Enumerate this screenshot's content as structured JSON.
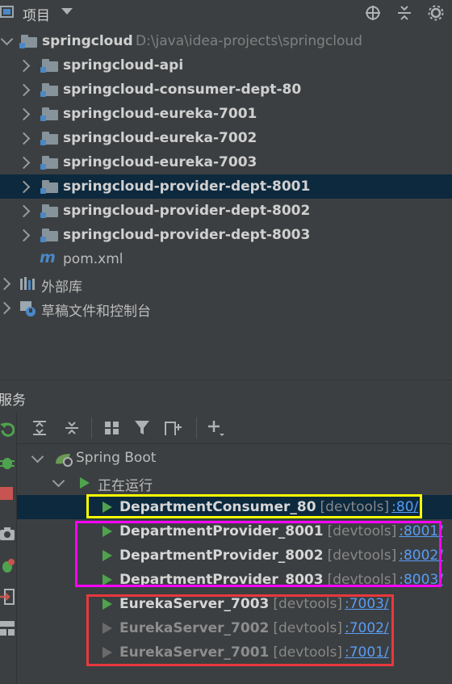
{
  "project_panel": {
    "title": "项目",
    "root": {
      "name": "springcloud",
      "path": "D:\\java\\idea-projects\\springcloud"
    },
    "modules": [
      "springcloud-api",
      "springcloud-consumer-dept-80",
      "springcloud-eureka-7001",
      "springcloud-eureka-7002",
      "springcloud-eureka-7003",
      "springcloud-provider-dept-8001",
      "springcloud-provider-dept-8002",
      "springcloud-provider-dept-8003"
    ],
    "pom_file": "pom.xml",
    "external_libraries": "外部库",
    "scratches": "草稿文件和控制台"
  },
  "services_panel": {
    "title": "服务",
    "spring_boot_label": "Spring Boot",
    "running_label": "正在运行",
    "services": [
      {
        "name": "DepartmentConsumer_80",
        "tag": "[devtools]",
        "port": ":80/"
      },
      {
        "name": "DepartmentProvider_8001",
        "tag": "[devtools]",
        "port": ":8001/"
      },
      {
        "name": "DepartmentProvider_8002",
        "tag": "[devtools]",
        "port": ":8002/"
      },
      {
        "name": "DepartmentProvider_8003",
        "tag": "[devtools]",
        "port": ":8003/"
      },
      {
        "name": "EurekaServer_7003",
        "tag": "[devtools]",
        "port": ":7003/"
      },
      {
        "name": "EurekaServer_7002",
        "tag": "[devtools]",
        "port": ":7002/"
      },
      {
        "name": "EurekaServer_7001",
        "tag": "[devtools]",
        "port": ":7001/"
      }
    ]
  },
  "colors": {
    "selection": "#0d293e",
    "consumer_highlight": "#ffff00",
    "provider_highlight": "#ff00ff",
    "eureka_highlight": "#e8383d",
    "run_green": "#4fa34f",
    "link_blue": "#589df6"
  }
}
